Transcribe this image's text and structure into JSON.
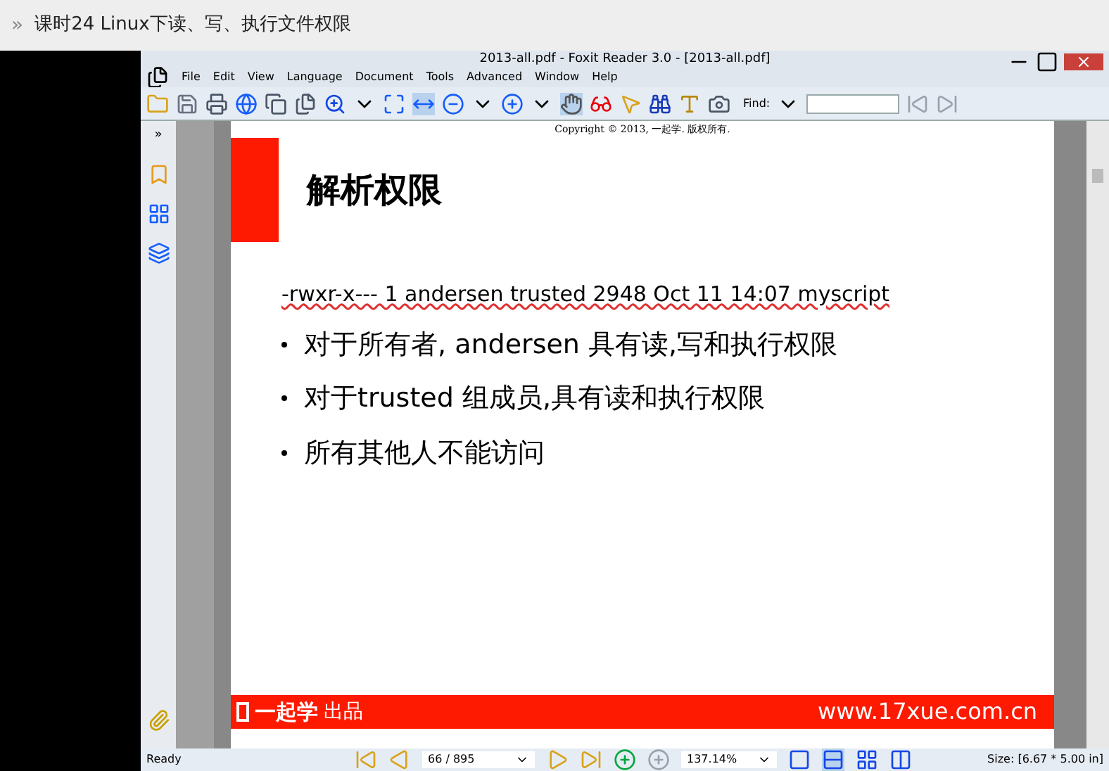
{
  "header": {
    "marker": "»",
    "title": "课时24  Linux下读、写、执行文件权限"
  },
  "window": {
    "title": "2013-all.pdf - Foxit Reader 3.0 - [2013-all.pdf]"
  },
  "menu": [
    "File",
    "Edit",
    "View",
    "Language",
    "Document",
    "Tools",
    "Advanced",
    "Window",
    "Help"
  ],
  "toolbar": {
    "find_label": "Find:"
  },
  "panel": {
    "collapse": "»"
  },
  "slide": {
    "copyright": "Copyright © 2013, 一起学. 版权所有.",
    "title": "解析权限",
    "command": "-rwxr-x--- 1 andersen trusted 2948 Oct 11 14:07 myscript",
    "bullets": [
      "对于所有者, andersen 具有读,写和执行权限",
      "对于trusted 组成员,具有读和执行权限",
      "所有其他人不能访问"
    ],
    "footer_brand": "一起学",
    "footer_suffix": "出品",
    "footer_url": "www.17xue.com.cn"
  },
  "status_bar": {
    "status": "Ready",
    "page": "66 / 895",
    "zoom": "137.14%",
    "size": "Size: [6.67 * 5.00 in]"
  }
}
